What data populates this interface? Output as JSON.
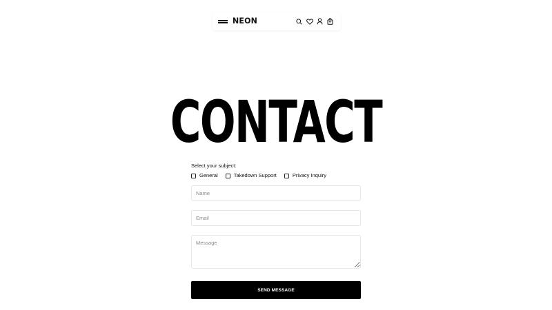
{
  "header": {
    "logo": "NEON",
    "icons": [
      "menu-icon",
      "search-icon",
      "heart-icon",
      "user-icon",
      "cart-icon"
    ]
  },
  "page_title": "CONTACT",
  "form": {
    "subject_label": "Select your subject:",
    "subjects": [
      {
        "label": "General",
        "checked": false
      },
      {
        "label": "Takedown Support",
        "checked": false
      },
      {
        "label": "Privacy Inquiry",
        "checked": false
      }
    ],
    "name_placeholder": "Name",
    "email_placeholder": "Email",
    "message_placeholder": "Message",
    "submit_label": "SEND MESSAGE"
  },
  "colors": {
    "text": "#111111",
    "button_bg": "#000000",
    "button_text": "#ffffff",
    "field_border": "#e6e6e6",
    "placeholder": "#8a8a8a"
  }
}
